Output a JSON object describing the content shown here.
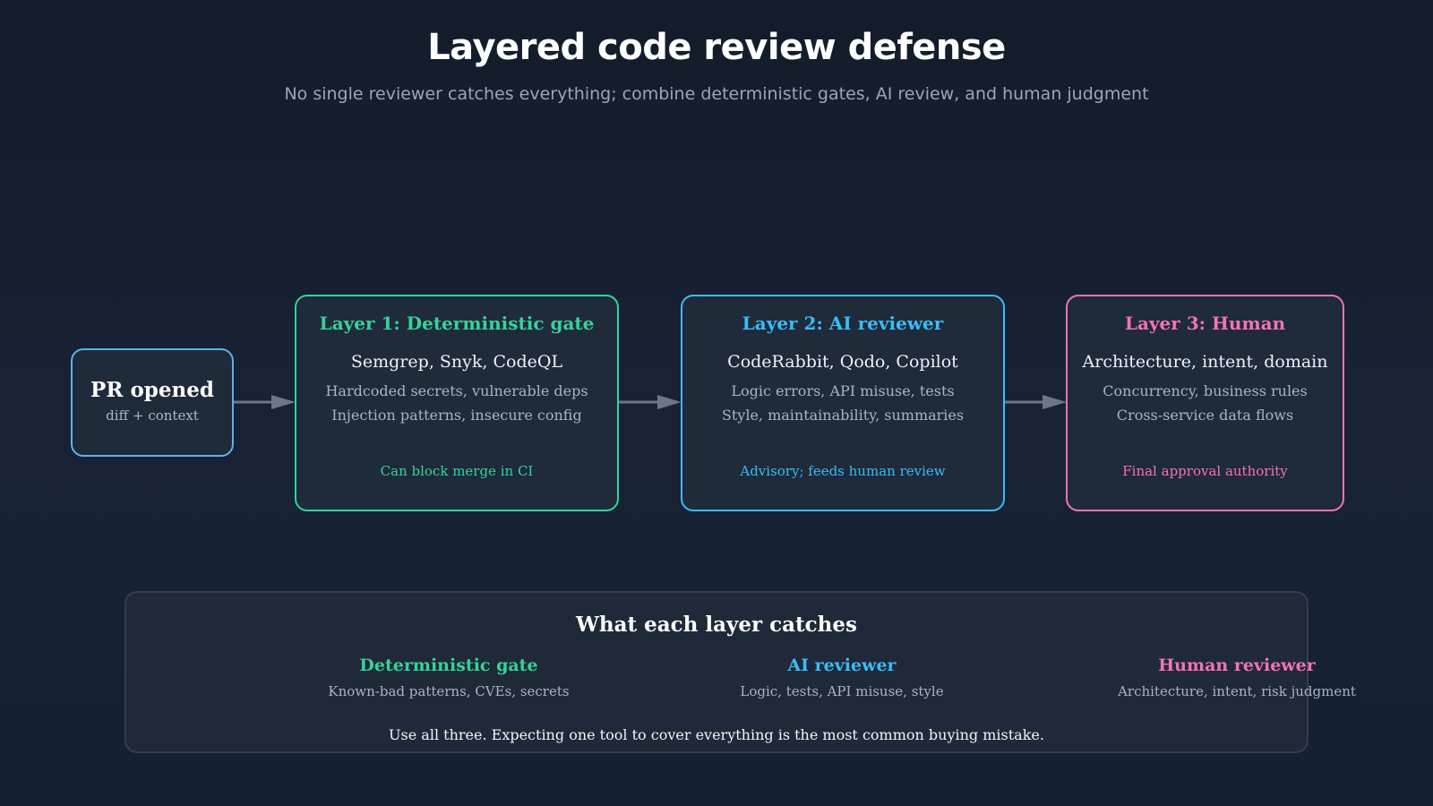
{
  "header": {
    "title": "Layered code review defense",
    "subtitle": "No single reviewer catches everything; combine deterministic gates, AI review, and human judgment"
  },
  "pr": {
    "title": "PR opened",
    "subtitle": "diff + context"
  },
  "layers": [
    {
      "title": "Layer 1: Deterministic gate",
      "tools": "Semgrep, Snyk, CodeQL",
      "line1": "Hardcoded secrets, vulnerable deps",
      "line2": "Injection patterns, insecure config",
      "note": "Can block merge in CI",
      "color": "#34d399"
    },
    {
      "title": "Layer 2: AI reviewer",
      "tools": "CodeRabbit, Qodo, Copilot",
      "line1": "Logic errors, API misuse, tests",
      "line2": "Style, maintainability, summaries",
      "note": "Advisory; feeds human review",
      "color": "#38bdf8"
    },
    {
      "title": "Layer 3: Human",
      "tools": "Architecture, intent, domain",
      "line1": "Concurrency, business rules",
      "line2": "Cross-service data flows",
      "note": "Final approval authority",
      "color": "#f472b6"
    }
  ],
  "summary": {
    "title": "What each layer catches",
    "columns": [
      {
        "heading": "Deterministic gate",
        "text": "Known-bad patterns, CVEs, secrets"
      },
      {
        "heading": "AI reviewer",
        "text": "Logic, tests, API misuse, style"
      },
      {
        "heading": "Human reviewer",
        "text": "Architecture, intent, risk judgment"
      }
    ],
    "footer": "Use all three. Expecting one tool to cover everything is the most common buying mistake."
  },
  "colors": {
    "background": "#172133",
    "pr_border": "#5bb2ea",
    "arrow": "#6b7789"
  }
}
